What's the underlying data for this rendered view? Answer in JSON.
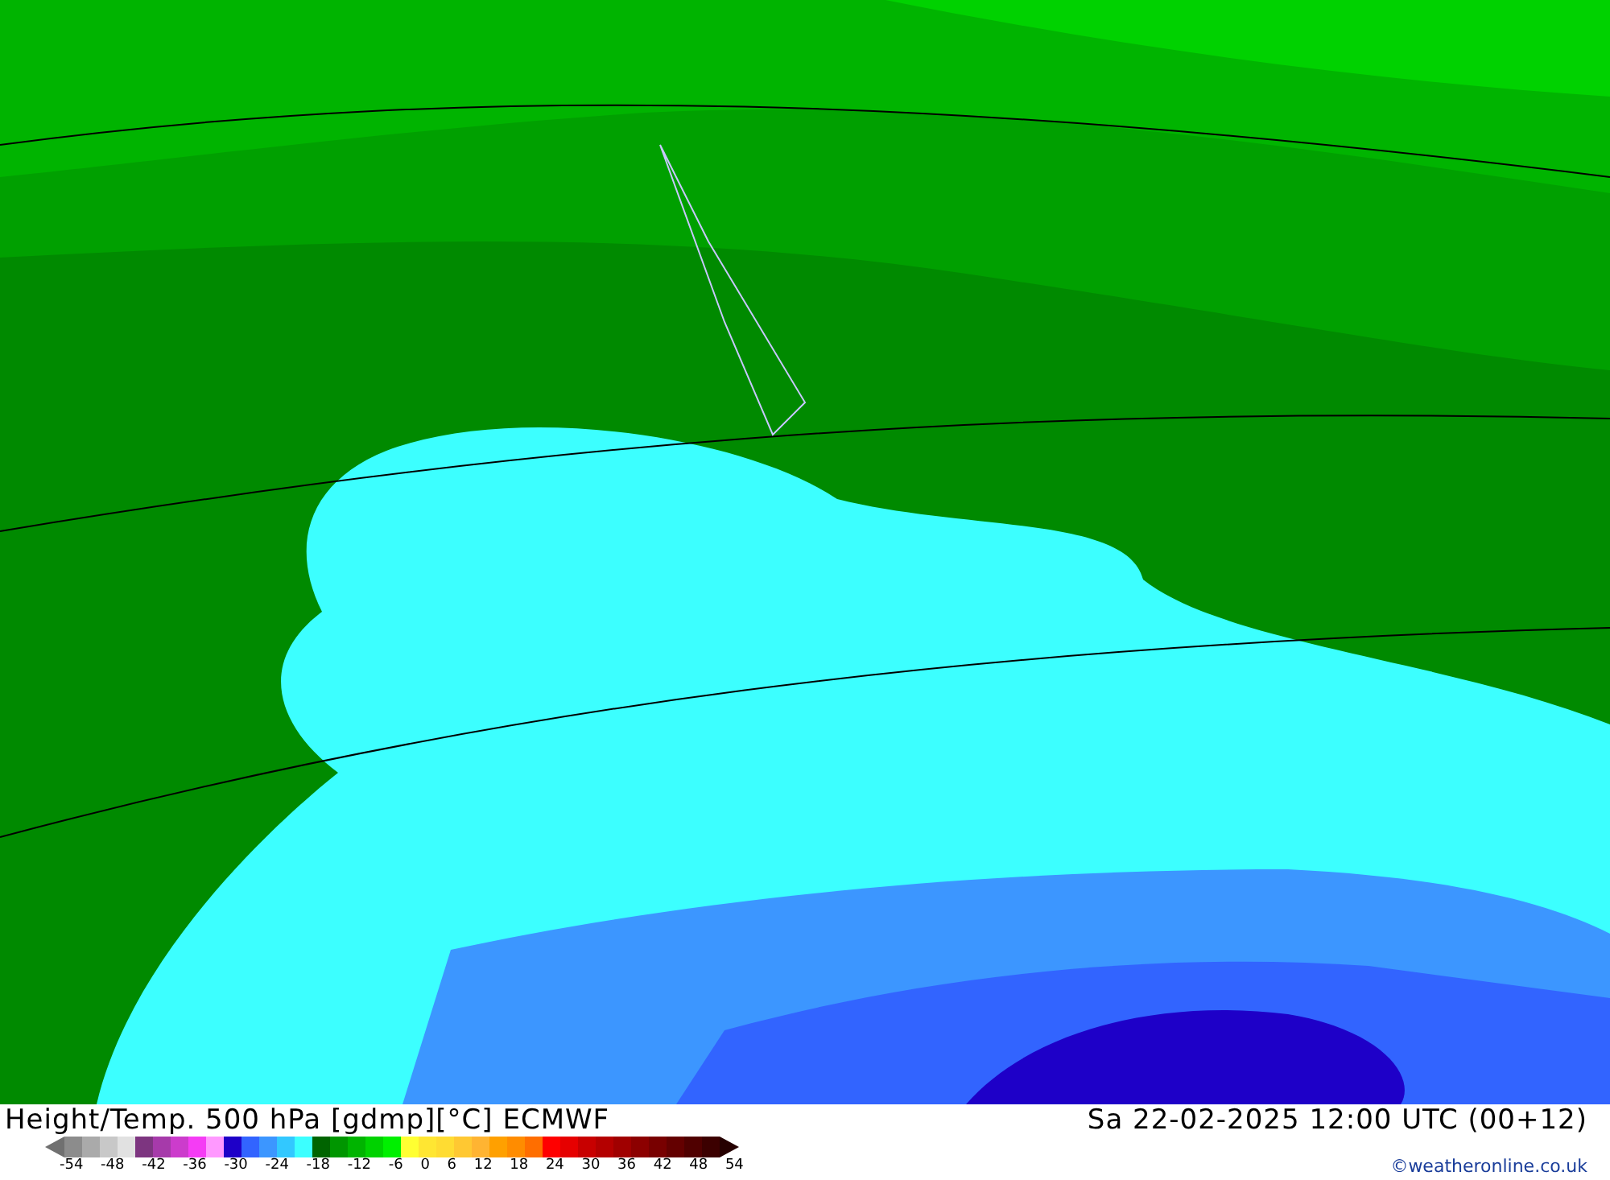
{
  "title": "Height/Temp. 500 hPa [gdmp][°C] ECMWF",
  "valid_time": "Sa 22-02-2025 12:00 UTC (00+12)",
  "legend": {
    "swatches": [
      {
        "color": "#8c8c8c"
      },
      {
        "color": "#aaaaaa"
      },
      {
        "color": "#c8c8c8"
      },
      {
        "color": "#e1e1e1"
      },
      {
        "color": "#7d3580"
      },
      {
        "color": "#a63aaa"
      },
      {
        "color": "#cc3ccc"
      },
      {
        "color": "#f53cf5"
      },
      {
        "color": "#ff99ff"
      },
      {
        "color": "#1e00c8"
      },
      {
        "color": "#3264ff"
      },
      {
        "color": "#3c96ff"
      },
      {
        "color": "#32c8ff"
      },
      {
        "color": "#3cffff"
      },
      {
        "color": "#006400"
      },
      {
        "color": "#009600"
      },
      {
        "color": "#00b400"
      },
      {
        "color": "#00d200"
      },
      {
        "color": "#00f000"
      },
      {
        "color": "#ffff32"
      },
      {
        "color": "#ffe632"
      },
      {
        "color": "#ffdc32"
      },
      {
        "color": "#ffc832"
      },
      {
        "color": "#ffb432"
      },
      {
        "color": "#ffa000"
      },
      {
        "color": "#ff8c00"
      },
      {
        "color": "#ff6e00"
      },
      {
        "color": "#ff0000"
      },
      {
        "color": "#e60000"
      },
      {
        "color": "#c80000"
      },
      {
        "color": "#b40000"
      },
      {
        "color": "#a00000"
      },
      {
        "color": "#8c0000"
      },
      {
        "color": "#780000"
      },
      {
        "color": "#640000"
      },
      {
        "color": "#500000"
      },
      {
        "color": "#3c0000"
      }
    ],
    "ticks": [
      "-54",
      "-48",
      "-42",
      "-36",
      "-30",
      "-24",
      "-18",
      "-12",
      "-6",
      "0",
      "6",
      "12",
      "18",
      "24",
      "30",
      "36",
      "42",
      "48",
      "54"
    ]
  },
  "copyright": "©weatheronline.co.uk"
}
